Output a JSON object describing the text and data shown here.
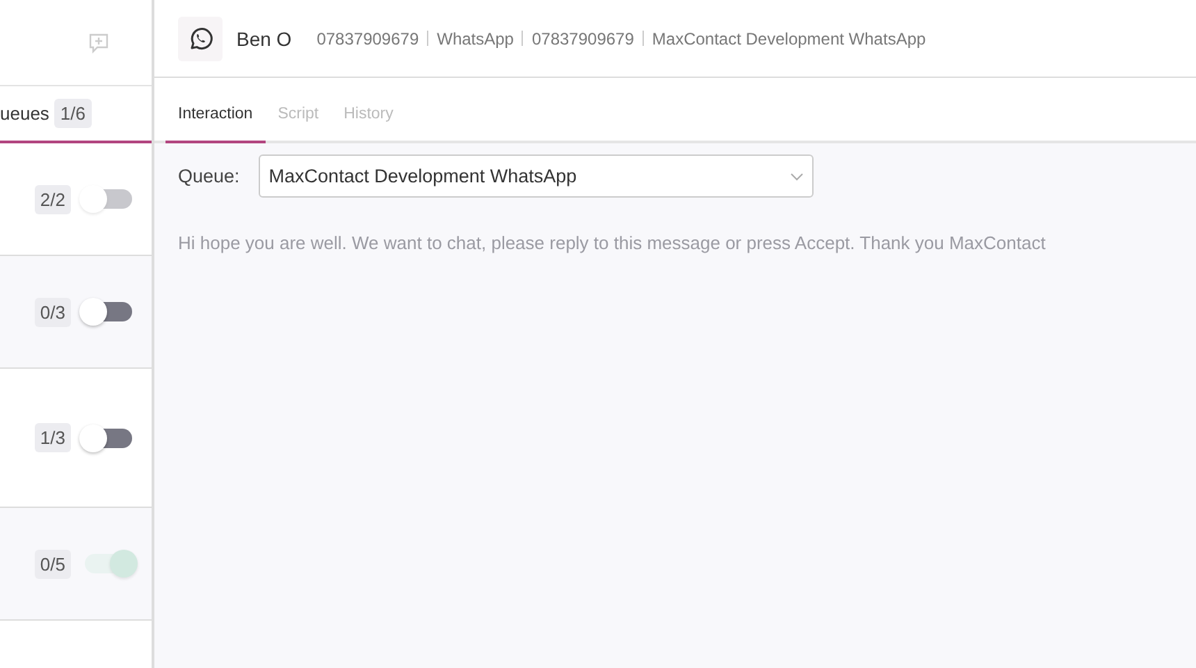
{
  "sidebar": {
    "tab": {
      "label": "ueues",
      "count": "1/6"
    },
    "queues": [
      {
        "count": "2/2",
        "on": false,
        "disabled": true
      },
      {
        "count": "0/3",
        "on": false,
        "disabled": false
      },
      {
        "count": "1/3",
        "on": false,
        "disabled": false
      },
      {
        "count": "0/5",
        "on": true,
        "disabled": true
      }
    ]
  },
  "contact": {
    "name": "Ben O",
    "details": [
      "07837909679",
      "WhatsApp",
      "07837909679",
      "MaxContact Development WhatsApp"
    ]
  },
  "tabs": [
    {
      "label": "Interaction",
      "selected": true
    },
    {
      "label": "Script",
      "selected": false
    },
    {
      "label": "History",
      "selected": false
    }
  ],
  "queue_field": {
    "label": "Queue:",
    "value": "MaxContact Development WhatsApp"
  },
  "message": {
    "placeholder": "Hi hope you are well. We want to chat, please reply to this message or press Accept. Thank you MaxContact"
  }
}
